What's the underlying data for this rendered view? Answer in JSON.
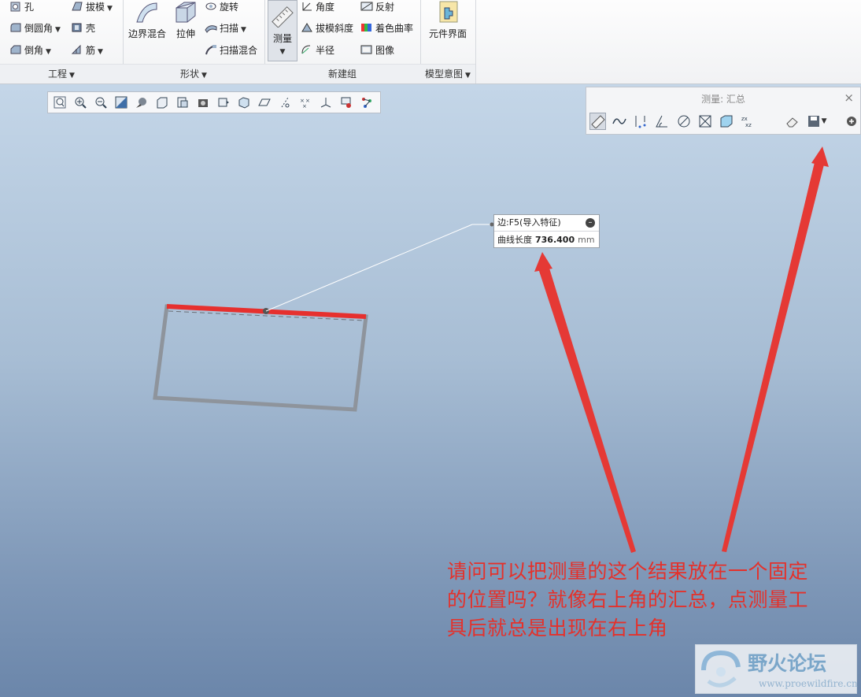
{
  "ribbon": {
    "groups": {
      "engineering": {
        "label": "工程",
        "hole": "孔",
        "draft": "拔模",
        "round": "倒圆角",
        "shell": "壳",
        "chamfer": "倒角",
        "rib": "筋"
      },
      "shapes": {
        "label": "形状",
        "boundary_blend": "边界混合",
        "extrude": "拉伸",
        "revolve": "旋转",
        "sweep": "扫描",
        "swept_blend": "扫描混合"
      },
      "new_group": {
        "label": "新建组",
        "measure": "测量",
        "angle": "角度",
        "draft_slope": "拔模斜度",
        "radius": "半径",
        "reflection": "反射",
        "shaded_curvature": "着色曲率",
        "image": "图像"
      },
      "model_intent": {
        "label": "模型意图",
        "component_interface": "元件界面"
      }
    }
  },
  "measure_panel": {
    "title": "测量: 汇总",
    "close": "×"
  },
  "callout": {
    "header": "边:F5(导入特征)",
    "label": "曲线长度",
    "value": "736.400",
    "unit": "mm"
  },
  "annotation": {
    "lines": [
      "请问可以把测量的这个结果放在一个固定",
      "的位置吗？就像右上角的汇总，点测量工",
      "具后就总是出现在右上角"
    ]
  },
  "watermark": {
    "title": "野火论坛",
    "url": "www.proewildfire.cn"
  },
  "colors": {
    "accent_red": "#e4312b",
    "ribbon_bg": "#f1f2f4",
    "canvas_top": "#c4d6e8",
    "canvas_bottom": "#6b86aa"
  }
}
